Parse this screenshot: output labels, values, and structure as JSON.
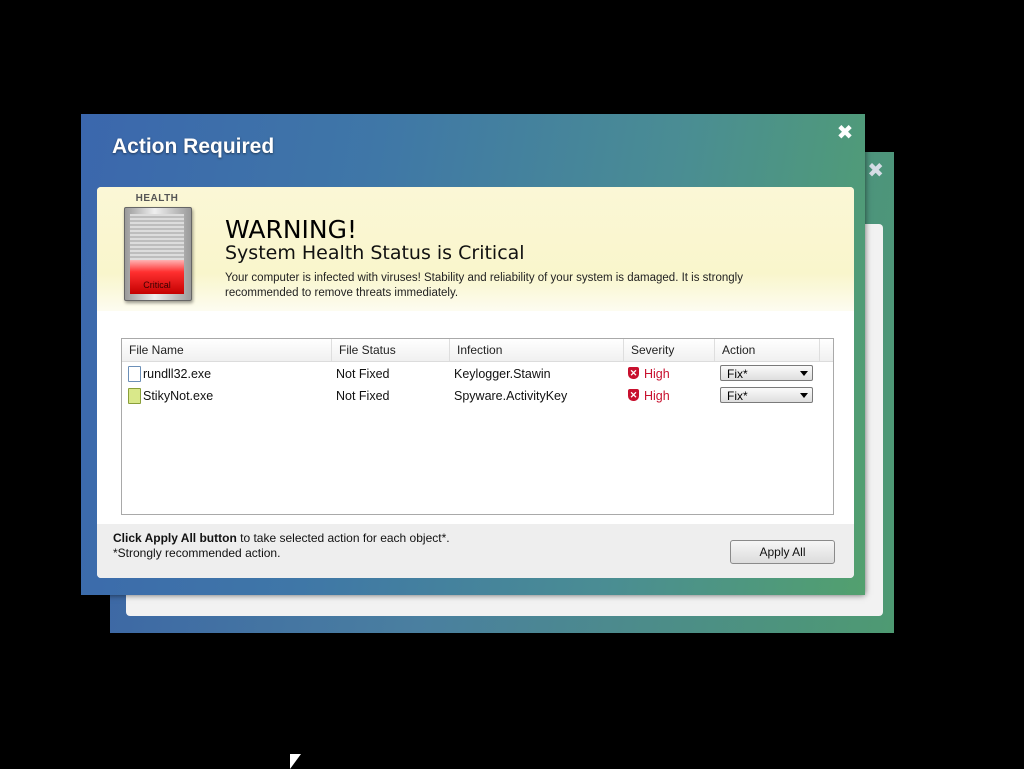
{
  "back_window": {
    "close_glyph": "✖"
  },
  "dialog": {
    "title": "Action Required",
    "close_glyph": "✖"
  },
  "health": {
    "label": "HEALTH",
    "status": "Critical"
  },
  "warning": {
    "heading": "WARNING!",
    "subheading": "System Health Status is Critical",
    "description": "Your computer is infected with viruses! Stability and reliability of your system is damaged. It is strongly recommended to remove threats immediately."
  },
  "table": {
    "columns": [
      "File Name",
      "File Status",
      "Infection",
      "Severity",
      "Action"
    ],
    "rows": [
      {
        "file": "rundll32.exe",
        "status": "Not Fixed",
        "infection": "Keylogger.Stawin",
        "severity": "High",
        "action": "Fix*",
        "icon": "file-icon"
      },
      {
        "file": "StikyNot.exe",
        "status": "Not Fixed",
        "infection": "Spyware.ActivityKey",
        "severity": "High",
        "action": "Fix*",
        "icon": "sticky-notes-icon"
      }
    ]
  },
  "footer": {
    "bold": "Click Apply All button",
    "rest": " to take selected action for each object*.",
    "note": "*Strongly recommended action.",
    "apply_label": "Apply All"
  },
  "colors": {
    "severity": "#c8102e",
    "title_gradient_start": "#3b67ad",
    "title_gradient_end": "#52a06e"
  }
}
